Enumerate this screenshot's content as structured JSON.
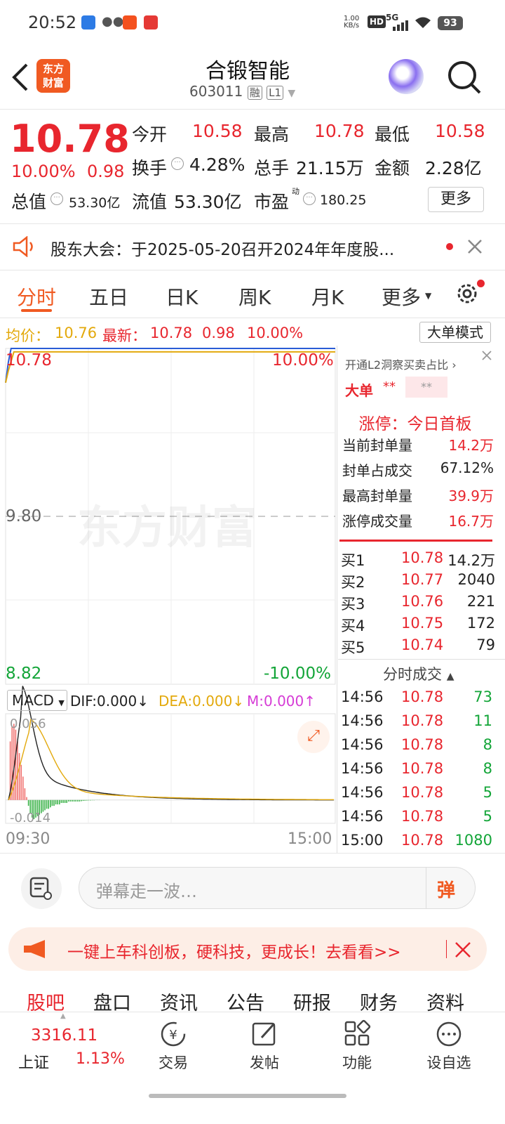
{
  "status": {
    "time": "20:52",
    "speed_value": "1.00",
    "speed_unit": "KB/s",
    "hd": "HD",
    "network": "5G",
    "battery": "93"
  },
  "header": {
    "brand_line1": "东方",
    "brand_line2": "财富",
    "title": "合锻智能",
    "code": "603011",
    "tag_rong": "融",
    "tag_l1": "L1"
  },
  "quote": {
    "price": "10.78",
    "pct": "10.00%",
    "chg": "0.98",
    "open_label": "今开",
    "open": "10.58",
    "high_label": "最高",
    "high": "10.78",
    "low_label": "最低",
    "low": "10.58",
    "turnover_label": "换手",
    "turnover": "4.28%",
    "volume_label": "总手",
    "volume": "21.15万",
    "amount_label": "金额",
    "amount": "2.28亿",
    "mktcap_label": "总值",
    "mktcap": "53.30亿",
    "float_label": "流值",
    "float": "53.30亿",
    "pe_label": "市盈",
    "pe_sup": "动",
    "pe": "180.25",
    "more_btn": "更多"
  },
  "notice": {
    "text": "股东大会：于2025-05-20召开2024年年度股..."
  },
  "tabs": [
    "分时",
    "五日",
    "日K",
    "周K",
    "月K",
    "更多"
  ],
  "chart_header": {
    "avg_label": "均价：",
    "avg": "10.76",
    "latest_label": "最新：",
    "latest": "10.78",
    "chg": "0.98",
    "pct": "10.00%",
    "bigorder_btn": "大单模式"
  },
  "chart_data": [
    {
      "type": "line",
      "x_range": [
        "09:30",
        "15:00"
      ],
      "ylim": [
        8.82,
        10.78
      ],
      "y_labels": {
        "top": "10.78",
        "mid": "9.80",
        "bottom": "8.82"
      },
      "pct_labels": {
        "top": "10.00%",
        "bottom": "-10.00%"
      },
      "series": [
        {
          "name": "价格",
          "color": "#2a5cd6",
          "x": [
            0,
            2,
            4,
            240
          ],
          "y": [
            10.58,
            10.7,
            10.78,
            10.78
          ]
        },
        {
          "name": "均价",
          "color": "#e3a90c",
          "x": [
            0,
            2,
            6,
            240
          ],
          "y": [
            10.58,
            10.65,
            10.76,
            10.76
          ]
        }
      ]
    },
    {
      "type": "bar",
      "indicator": "MACD",
      "dif_label": "DIF:",
      "dif": "0.000",
      "dea_label": "DEA:",
      "dea": "0.000",
      "m_label": "M:",
      "m": "0.000",
      "top_label": "0.056",
      "bottom_label": "-0.014",
      "x_start": "09:30",
      "x_end": "15:00",
      "ylim": [
        -0.014,
        0.056
      ],
      "bar_x": [
        1,
        2,
        3,
        4,
        5,
        6,
        7,
        8,
        9,
        10,
        11,
        12,
        13,
        14,
        15,
        16,
        17,
        18,
        19,
        20,
        21,
        22,
        23,
        24,
        25,
        26,
        27,
        28,
        29,
        30,
        31,
        32,
        33,
        34,
        35,
        36,
        37,
        38,
        39,
        40,
        41,
        42,
        43,
        44,
        45,
        46,
        47,
        48,
        49,
        50
      ],
      "bar_values": [
        0.04,
        0.05,
        0.052,
        0.048,
        0.04,
        0.032,
        0.024,
        0.016,
        0.008,
        0.002,
        -0.004,
        -0.009,
        -0.012,
        -0.013,
        -0.012,
        -0.011,
        -0.01,
        -0.009,
        -0.008,
        -0.007,
        -0.006,
        -0.006,
        -0.005,
        -0.004,
        -0.004,
        -0.003,
        -0.003,
        -0.003,
        -0.002,
        -0.002,
        -0.002,
        -0.002,
        -0.001,
        -0.001,
        -0.001,
        -0.001,
        -0.001,
        -0.001,
        -0.001,
        -0.0008,
        -0.0006,
        -0.0005,
        -0.0004,
        -0.0003,
        -0.0003,
        -0.0002,
        -0.0002,
        -0.0001,
        -0.0001,
        -0.0001
      ]
    }
  ],
  "side": {
    "l2_text": "开通L2洞察买卖占比",
    "big_label": "大单",
    "big_v1": "**",
    "big_v2": "**",
    "limit_title": "涨停：今日首板",
    "rows": [
      {
        "label": "当前封单量",
        "value": "14.2万"
      },
      {
        "label": "封单占成交",
        "value": "67.12%"
      },
      {
        "label": "最高封单量",
        "value": "39.9万"
      },
      {
        "label": "涨停成交量",
        "value": "16.7万"
      }
    ],
    "bids": [
      {
        "l": "买1",
        "p": "10.78",
        "v": "14.2万"
      },
      {
        "l": "买2",
        "p": "10.77",
        "v": "2040"
      },
      {
        "l": "买3",
        "p": "10.76",
        "v": "221"
      },
      {
        "l": "买4",
        "p": "10.75",
        "v": "172"
      },
      {
        "l": "买5",
        "p": "10.74",
        "v": "79"
      }
    ],
    "ticks_title": "分时成交",
    "ticks": [
      {
        "t": "14:56",
        "p": "10.78",
        "v": "73"
      },
      {
        "t": "14:56",
        "p": "10.78",
        "v": "11"
      },
      {
        "t": "14:56",
        "p": "10.78",
        "v": "8"
      },
      {
        "t": "14:56",
        "p": "10.78",
        "v": "8"
      },
      {
        "t": "14:56",
        "p": "10.78",
        "v": "5"
      },
      {
        "t": "14:56",
        "p": "10.78",
        "v": "5"
      },
      {
        "t": "15:00",
        "p": "10.78",
        "v": "1080"
      }
    ]
  },
  "danmu": {
    "placeholder": "弹幕走一波…",
    "btn": "弹"
  },
  "banner": {
    "text": "一键上车科创板，硬科技，更成长！去看看>>"
  },
  "bottom_tabs": [
    "股吧",
    "盘口",
    "资讯",
    "公告",
    "研报",
    "财务",
    "资料"
  ],
  "nav": {
    "index_value": "3316.11",
    "index_name": "上证",
    "index_pct": "1.13%",
    "items": [
      "交易",
      "发帖",
      "功能",
      "设自选"
    ]
  },
  "watermark": "东方财富"
}
